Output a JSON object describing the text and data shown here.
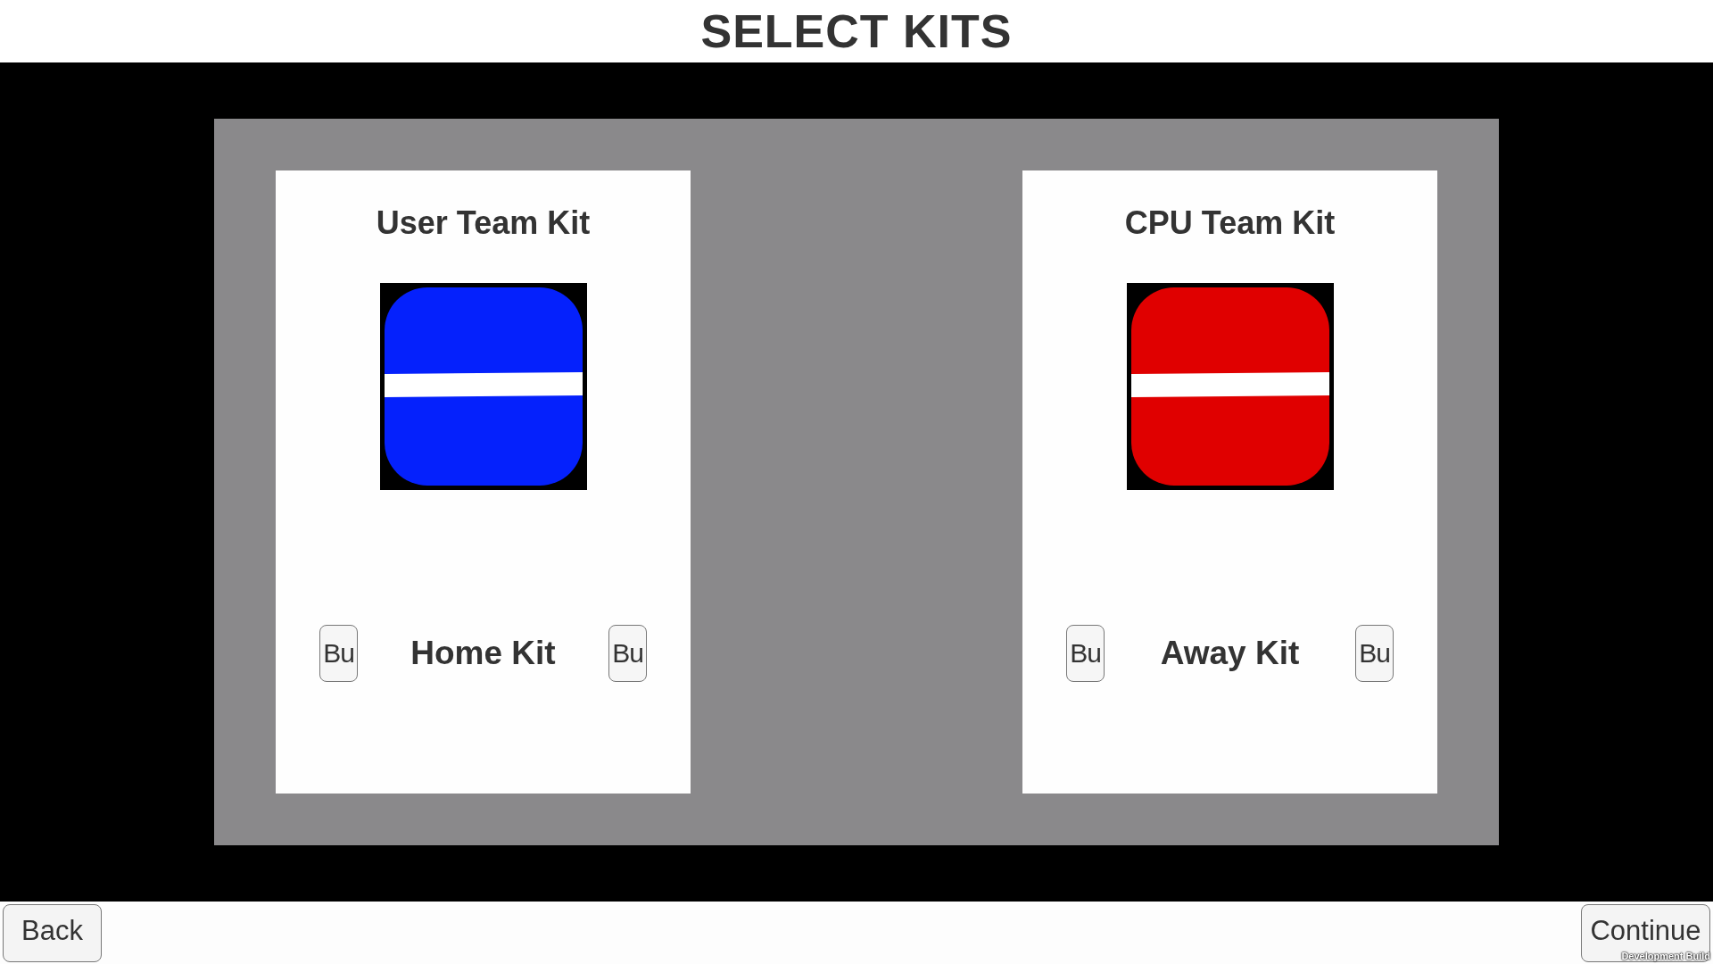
{
  "title": "SELECT KITS",
  "kits": [
    {
      "heading": "User Team Kit",
      "color": "#0521fc",
      "prev_button": "Bu",
      "kit_name": "Home Kit",
      "next_button": "Bu"
    },
    {
      "heading": "CPU Team Kit",
      "color": "#e00000",
      "prev_button": "Bu",
      "kit_name": "Away Kit",
      "next_button": "Bu"
    }
  ],
  "footer": {
    "back_button": "Back",
    "continue_button": "Continue",
    "build_label": "Development Build"
  }
}
